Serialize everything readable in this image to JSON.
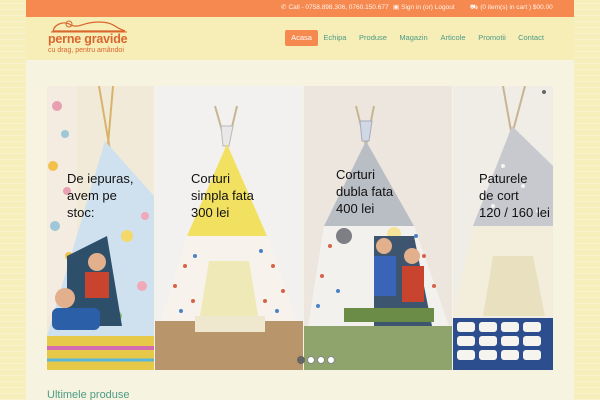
{
  "topbar": {
    "phone": "Call - 0758.898.306, 0760.150.677",
    "account": "Sign in (or) Logout",
    "cart": "(0 item(s) in cart ) $00.00"
  },
  "logo": {
    "name": "perne gravide",
    "tagline": "cu drag, pentru amândoi"
  },
  "nav": {
    "items": [
      {
        "label": "Acasa",
        "active": true
      },
      {
        "label": "Echipa",
        "active": false
      },
      {
        "label": "Produse",
        "active": false
      },
      {
        "label": "Magazin",
        "active": false
      },
      {
        "label": "Articole",
        "active": false
      },
      {
        "label": "Promotii",
        "active": false
      },
      {
        "label": "Contact",
        "active": false
      }
    ]
  },
  "slides": [
    {
      "caption": [
        "De iepuras,",
        "avem pe",
        "stoc:"
      ]
    },
    {
      "caption": [
        "Corturi",
        "simpla fata",
        "300 lei"
      ]
    },
    {
      "caption": [
        "Corturi",
        "dubla fata",
        "400 lei"
      ]
    },
    {
      "caption": [
        "Paturele",
        "de cort",
        "120 / 160 lei"
      ]
    }
  ],
  "slider_dots": 4,
  "slider_active_dot": 0,
  "section": {
    "title": "Ultimele produse"
  },
  "colors": {
    "accent": "#f5894f",
    "nav_text": "#4c9c86",
    "header_bg": "#f7edb7",
    "logo_text": "#d9662d"
  }
}
